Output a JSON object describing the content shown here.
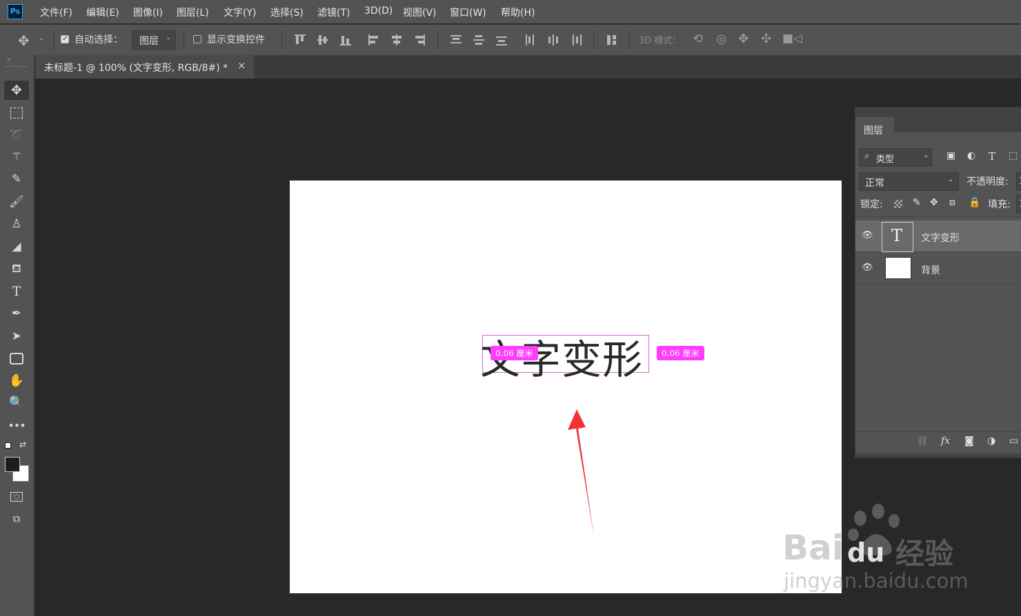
{
  "app": {
    "logo": "Ps"
  },
  "menu": [
    "文件(F)",
    "编辑(E)",
    "图像(I)",
    "图层(L)",
    "文字(Y)",
    "选择(S)",
    "滤镜(T)",
    "3D(D)",
    "视图(V)",
    "窗口(W)",
    "帮助(H)"
  ],
  "options": {
    "auto_select_label": "自动选择：",
    "auto_select_checked": true,
    "auto_select_target": "图层",
    "show_transform_label": "显示变换控件",
    "show_transform_checked": false,
    "mode_3d_label": "3D 模式："
  },
  "document": {
    "tab_title": "未标题-1 @ 100% (文字变形, RGB/8#) *",
    "close_glyph": "×",
    "canvas_text": "文字变形",
    "measure_left": "0.06 厘米",
    "measure_right": "0.06 厘米"
  },
  "layers_panel": {
    "tab_label": "图层",
    "filter_label": "类型",
    "blend_mode": "正常",
    "opacity_label": "不透明度:",
    "opacity_value": "1",
    "lock_label": "锁定:",
    "fill_label": "填充:",
    "fill_value": "1",
    "layers": [
      {
        "name": "文字变形",
        "thumb_glyph": "T",
        "selected": true,
        "visible": true
      },
      {
        "name": "背景",
        "thumb_glyph": "",
        "selected": false,
        "visible": true
      }
    ],
    "footer_fx": "fx"
  },
  "watermark": {
    "brand": "Bai",
    "brand2": "du",
    "suffix": "经验",
    "url": "jingyan.baidu.com"
  },
  "colors": {
    "bg": "#282828",
    "ui": "#535353",
    "measure": "#ff3cff",
    "arrow": "#f2343a",
    "ps_accent": "#31a8ff"
  },
  "icons": [
    "move-icon",
    "marquee-icon",
    "lasso-icon",
    "magic-wand-icon",
    "eyedropper-icon",
    "brush-icon",
    "stamp-icon",
    "eraser-icon",
    "paint-bucket-icon",
    "type-icon",
    "pen-icon",
    "path-select-icon",
    "rectangle-icon",
    "hand-icon",
    "zoom-icon",
    "more-icon",
    "quick-mask-icon",
    "screen-mode-icon"
  ]
}
